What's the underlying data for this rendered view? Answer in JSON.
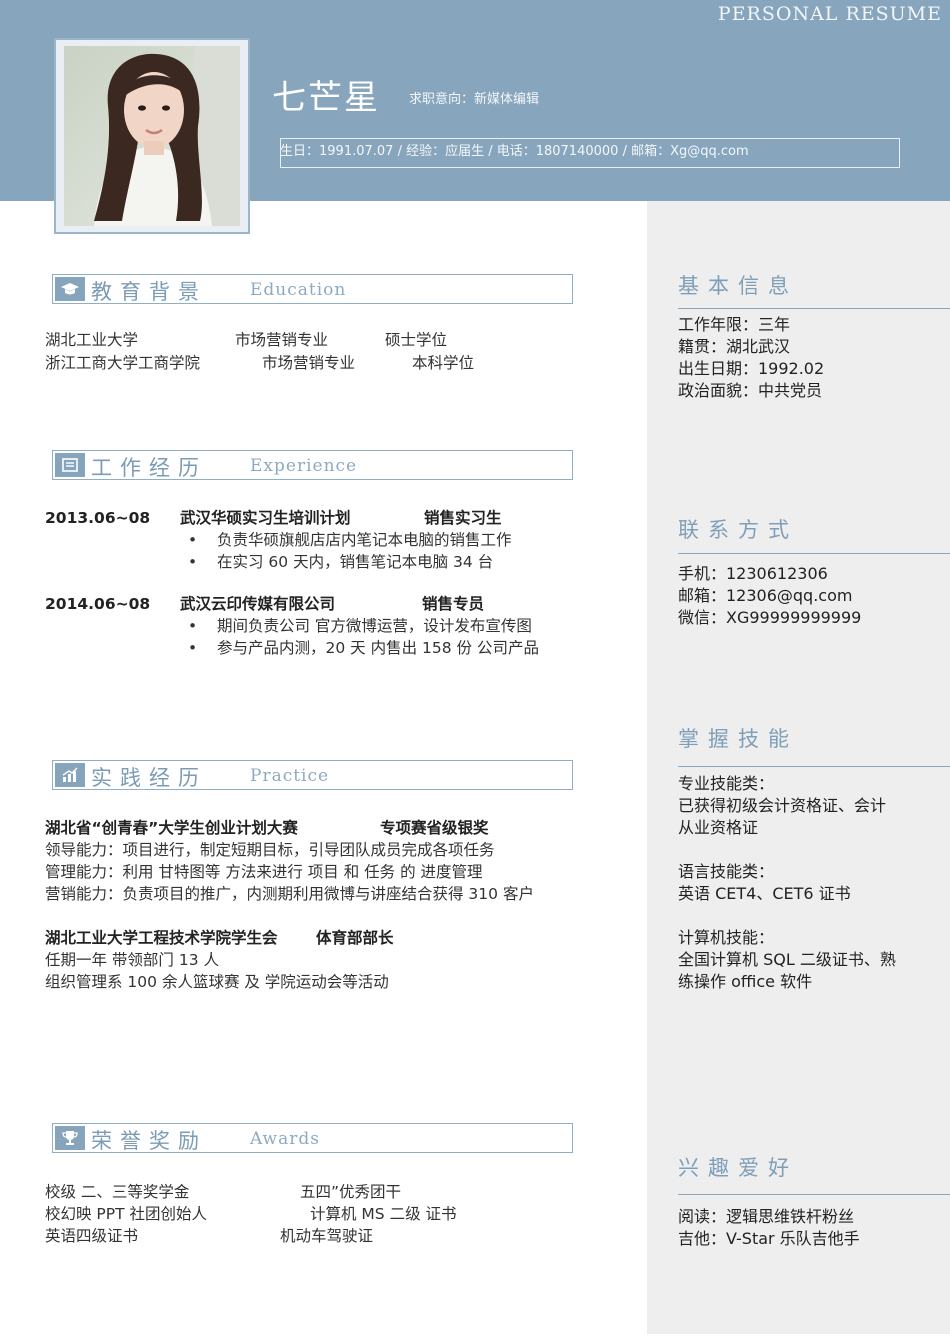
{
  "header": {
    "resume_tag": "PERSONAL RESUME",
    "name": "七芒星",
    "intent": "求职意向：新媒体编辑",
    "contact_line": "生日：1991.07.07 / 经验：应届生 / 电话：1807140000   / 邮箱：Xg@qq.com",
    "bg_color": "#87a6be"
  },
  "education": {
    "title": "教育背景",
    "en": "Education",
    "rows": [
      {
        "school": "湖北工业大学",
        "major": "市场营销专业",
        "degree": "硕士学位"
      },
      {
        "school": "浙江工商大学工商学院",
        "major": "市场营销专业",
        "degree": "本科学位"
      }
    ]
  },
  "experience": {
    "title": "工作经历",
    "en": "Experience",
    "items": [
      {
        "date": "2013.06~08",
        "company": "武汉华硕实习生培训计划",
        "role": "销售实习生",
        "bullets": [
          "负责华硕旗舰店店内笔记本电脑的销售工作",
          "在实习 60 天内，销售笔记本电脑 34 台"
        ]
      },
      {
        "date": "2014.06~08",
        "company": "武汉云印传媒有限公司",
        "role": "销售专员",
        "bullets": [
          "期间负责公司 官方微博运营，设计发布宣传图",
          "参与产品内测，20 天 内售出 158 份 公司产品"
        ]
      }
    ]
  },
  "practice": {
    "title": "实践经历",
    "en": "Practice",
    "items": [
      {
        "heading": "湖北省“创青春”大学生创业计划大赛",
        "award": "专项赛省级银奖",
        "lines": [
          "领导能力：项目进行，制定短期目标，引导团队成员完成各项任务",
          "管理能力：利用  甘特图等  方法来进行 项目 和 任务 的 进度管理",
          "营销能力：负责项目的推广，内测期利用微博与讲座结合获得 310 客户"
        ]
      },
      {
        "heading": "湖北工业大学工程技术学院学生会",
        "award": "体育部部长",
        "lines": [
          "任期一年     带领部门 13 人",
          "组织管理系 100 余人篮球赛  及   学院运动会等活动"
        ]
      }
    ]
  },
  "awards": {
    "title": "荣誉奖励",
    "en": "Awards",
    "left": [
      "校级 二、三等奖学金",
      "校幻映 PPT 社团创始人",
      "英语四级证书"
    ],
    "right": [
      "五四”优秀团干",
      "计算机 MS 二级 证书",
      "机动车驾驶证"
    ]
  },
  "sidebar": {
    "basic": {
      "title": "基本信息",
      "lines": [
        "工作年限：三年",
        "籍贯：湖北武汉",
        "出生日期：1992.02",
        "政治面貌：中共党员"
      ]
    },
    "contact": {
      "title": "联系方式",
      "lines": [
        "手机：1230612306",
        "邮箱：12306@qq.com",
        "微信：XG99999999999"
      ]
    },
    "skills": {
      "title": "掌握技能",
      "lines": [
        "专业技能类：",
        "已获得初级会计资格证、会计",
        "从业资格证",
        "语言技能类：",
        "英语 CET4、CET6 证书",
        "计算机技能：",
        "全国计算机 SQL 二级证书、熟",
        "练操作 office 软件"
      ]
    },
    "hobbies": {
      "title": "兴趣爱好",
      "lines": [
        "阅读：逻辑思维铁杆粉丝",
        "吉他：V-Star 乐队吉他手"
      ]
    }
  }
}
